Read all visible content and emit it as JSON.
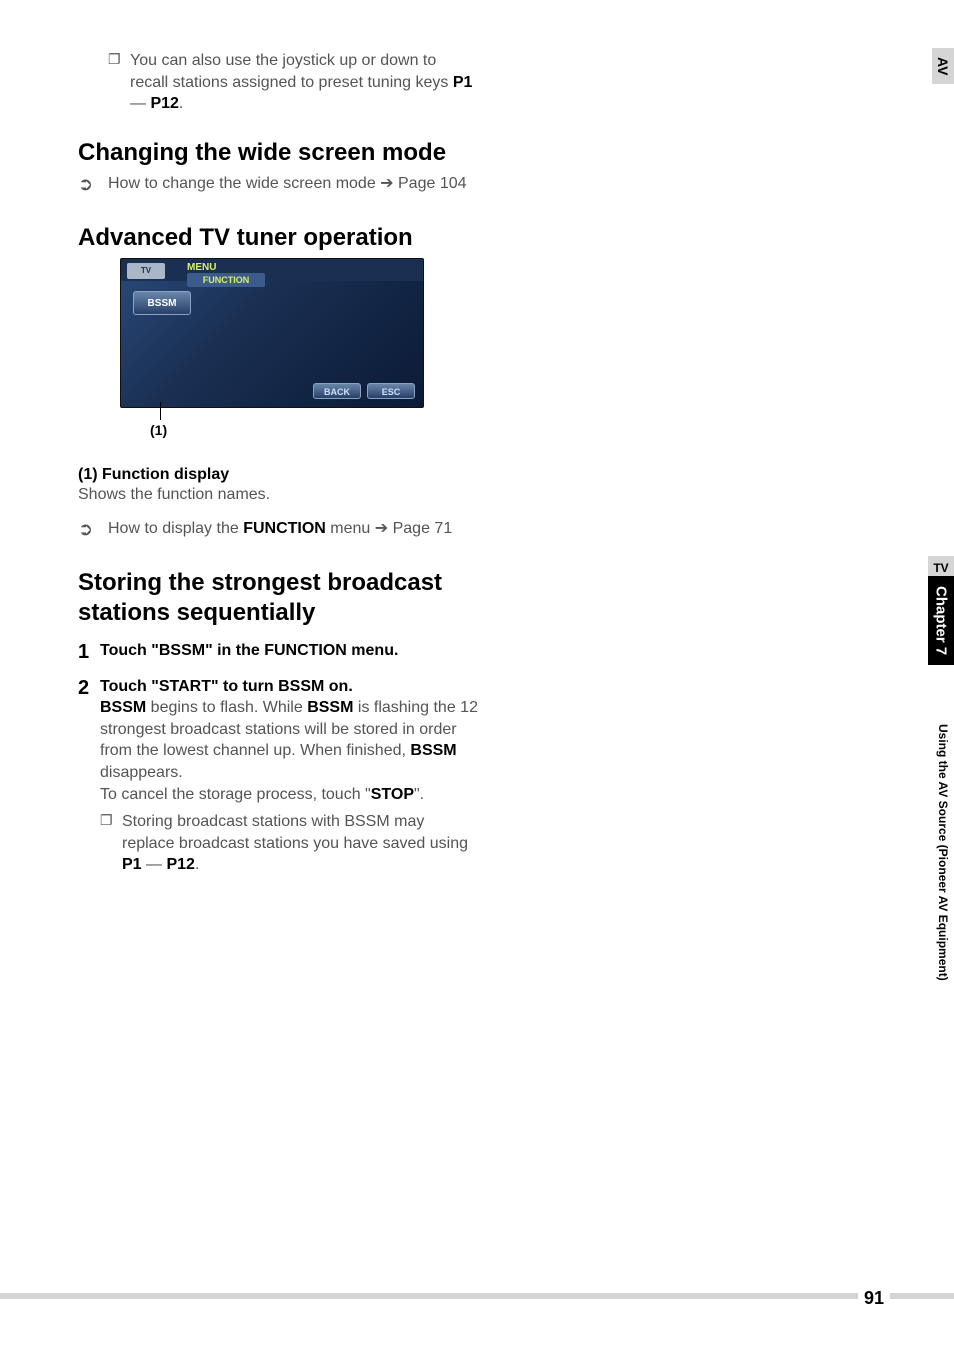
{
  "top_note": {
    "bullet": "❐",
    "text_pre": "You can also use the joystick up or down to recall stations assigned to preset tuning keys ",
    "p1": "P1",
    "sep": " — ",
    "p12": "P12",
    "end": "."
  },
  "section_wide": {
    "heading": "Changing the wide screen mode",
    "ref_icon": "➲",
    "ref_text": "How to change the wide screen mode ➔ Page 104"
  },
  "section_adv": {
    "heading": "Advanced TV tuner operation",
    "screenshot": {
      "src_label": "TV",
      "menu_label": "MENU",
      "function_label": "FUNCTION",
      "bssm_label": "BSSM",
      "back_label": "BACK",
      "esc_label": "ESC"
    },
    "callout": "(1)",
    "p_head": "(1) Function display",
    "p_body": "Shows the function names.",
    "ref_icon": "➲",
    "ref_text_pre": "How to display the ",
    "ref_text_bold": "FUNCTION",
    "ref_text_post": " menu ➔ Page 71"
  },
  "section_store": {
    "heading": "Storing the strongest broadcast stations sequentially",
    "steps": [
      {
        "num": "1",
        "lead_pre": "Touch \"BSSM\" in the ",
        "lead_bold": "FUNCTION",
        "lead_post": " menu."
      },
      {
        "num": "2",
        "lead": "Touch \"START\" to turn BSSM on.",
        "body_1a": "BSSM",
        "body_1b": " begins to flash. While ",
        "body_1c": "BSSM",
        "body_1d": " is flashing the 12 strongest broadcast stations will be stored in order from the lowest channel up. When finished, ",
        "body_1e": "BSSM",
        "body_1f": " disappears.",
        "body_2a": "To cancel the storage process, touch \"",
        "body_2b": "STOP",
        "body_2c": "\".",
        "note_bullet": "❐",
        "note_pre": "Storing broadcast stations with BSSM may replace broadcast stations you have saved using ",
        "note_p1": "P1",
        "note_sep": " — ",
        "note_p12": "P12",
        "note_end": "."
      }
    ]
  },
  "side": {
    "av": "AV",
    "current": "TV",
    "chapter": "Chapter 7",
    "detail": "Using the AV Source (Pioneer AV Equipment)"
  },
  "page_number": "91"
}
